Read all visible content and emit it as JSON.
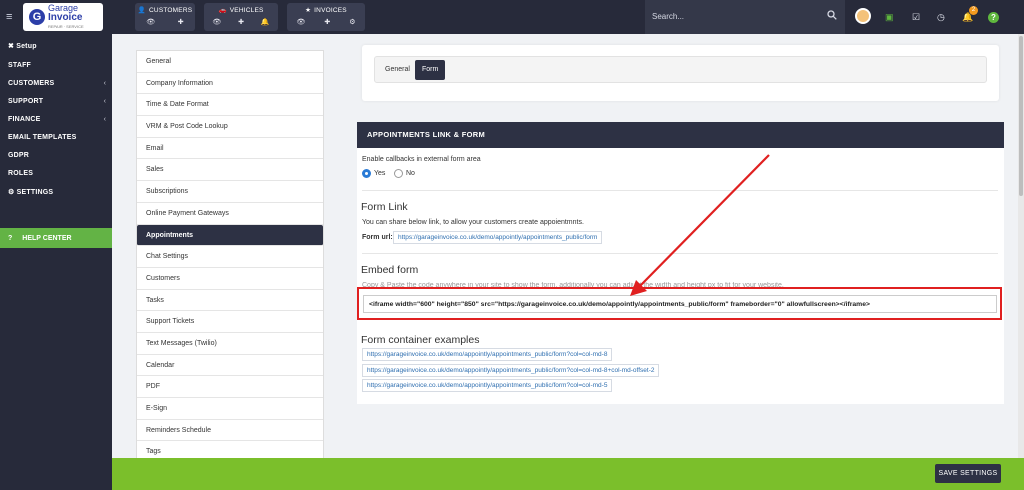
{
  "app": {
    "logo_line1": "Garage",
    "logo_line2": "Invoice",
    "logo_tagline": "REPAIR · SERVICE"
  },
  "topnav": {
    "customers": "CUSTOMERS",
    "vehicles": "VEHICLES",
    "invoices": "INVOICES",
    "search_placeholder": "Search...",
    "notification_count": "2"
  },
  "sidebar": {
    "setup": "Setup",
    "items": [
      {
        "label": "STAFF"
      },
      {
        "label": "CUSTOMERS"
      },
      {
        "label": "SUPPORT"
      },
      {
        "label": "FINANCE"
      },
      {
        "label": "EMAIL TEMPLATES"
      },
      {
        "label": "GDPR"
      },
      {
        "label": "ROLES"
      },
      {
        "label": "SETTINGS"
      }
    ],
    "help_center": "HELP CENTER"
  },
  "settings_menu": [
    "General",
    "Company Information",
    "Time & Date Format",
    "VRM & Post Code Lookup",
    "Email",
    "Sales",
    "Subscriptions",
    "Online Payment Gateways",
    "Appointments",
    "Chat Settings",
    "Customers",
    "Tasks",
    "Support Tickets",
    "Text Messages (Twilio)",
    "Calendar",
    "PDF",
    "E-Sign",
    "Reminders Schedule",
    "Tags"
  ],
  "tabs": {
    "general": "General",
    "form": "Form"
  },
  "card": {
    "title": "APPOINTMENTS LINK & FORM",
    "callbacks_label": "Enable callbacks in external form area",
    "yes": "Yes",
    "no": "No",
    "form_link_title": "Form Link",
    "form_link_desc": "You can share below link, to allow your customers create appoientmnts.",
    "form_url_label": "Form url:",
    "form_url": "https://garageinvoice.co.uk/demo/appointly/appointments_public/form",
    "embed_title": "Embed form",
    "embed_desc": "Copy & Paste the code anywhere in your site to show the form, additionally you can adjust the width and height px to fit for your website.",
    "embed_code": "<iframe width=\"600\" height=\"850\" src=\"https://garageinvoice.co.uk/demo/appointly/appointments_public/form\" frameborder=\"0\" allowfullscreen></iframe>",
    "container_title": "Form container examples",
    "examples": [
      "https://garageinvoice.co.uk/demo/appointly/appointments_public/form?col=col-md-8",
      "https://garageinvoice.co.uk/demo/appointly/appointments_public/form?col=col-md-8+col-md-offset-2",
      "https://garageinvoice.co.uk/demo/appointly/appointments_public/form?col=col-md-5"
    ]
  },
  "footer": {
    "save": "SAVE SETTINGS"
  },
  "colors": {
    "dark": "#272a3a",
    "accent_green": "#7bbf2b",
    "highlight_red": "#e02020",
    "link_blue": "#2f6fb0"
  }
}
